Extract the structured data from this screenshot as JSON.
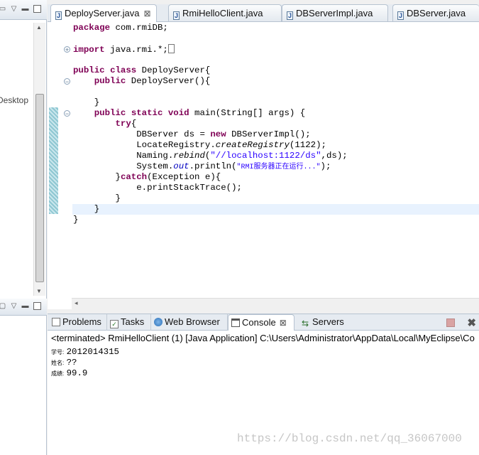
{
  "left_pane": {
    "desktop_label": "Desktop"
  },
  "editor": {
    "tabs": [
      {
        "label": "DeployServer.java",
        "active": true,
        "closable": true
      },
      {
        "label": "RmiHelloClient.java",
        "active": false
      },
      {
        "label": "DBServerImpl.java",
        "active": false
      },
      {
        "label": "DBServer.java",
        "active": false
      }
    ],
    "code": {
      "l1": "package com.rmiDB;",
      "l2_kw": "import",
      "l2_rest": " java.rmi.*;",
      "l3_kw1": "public",
      "l3_kw2": "class",
      "l3_rest": " DeployServer{",
      "l4_kw": "public",
      "l4_rest": " DeployServer(){",
      "l5": "}",
      "l6_kw1": "public",
      "l6_kw2": "static",
      "l6_kw3": "void",
      "l6_rest": " main(String[] args) {",
      "l7_kw": "try",
      "l7_rest": "{",
      "l8_a": "DBServer ds = ",
      "l8_kw": "new",
      "l8_b": " DBServerImpl();",
      "l9_a": "LocateRegistry.",
      "l9_it": "createRegistry",
      "l9_b": "(1122);",
      "l10_a": "Naming.",
      "l10_it": "rebind",
      "l10_b": "(",
      "l10_str": "\"//localhost:1122/ds\"",
      "l10_c": ",ds);",
      "l11_a": "System.",
      "l11_field": "out",
      "l11_b": ".println(",
      "l11_str": "\"RMI服务器正在运行...\"",
      "l11_c": ");",
      "l12_a": "}",
      "l12_kw": "catch",
      "l12_b": "(Exception e){",
      "l13": "e.printStackTrace();",
      "l14": "}",
      "l15": "}",
      "l16": "}"
    }
  },
  "console": {
    "tabs": [
      {
        "label": "Problems",
        "icon": "problems-icon"
      },
      {
        "label": "Tasks",
        "icon": "tasks-icon"
      },
      {
        "label": "Web Browser",
        "icon": "globe-icon"
      },
      {
        "label": "Console",
        "icon": "console-icon",
        "active": true
      },
      {
        "label": "Servers",
        "icon": "servers-icon"
      }
    ],
    "status": "<terminated> RmiHelloClient (1) [Java Application] C:\\Users\\Administrator\\AppData\\Local\\MyEclipse\\Co",
    "output": [
      {
        "label": "学号:",
        "value": "2012014315"
      },
      {
        "label": "姓名:",
        "value": "??"
      },
      {
        "label": "成绩:",
        "value": "99.9"
      }
    ]
  },
  "watermark": "https://blog.csdn.net/qq_36067000",
  "colors": {
    "keyword": "#7f0055",
    "string": "#2a00ff",
    "field": "#0000c0",
    "current_line": "#e8f2fe"
  }
}
